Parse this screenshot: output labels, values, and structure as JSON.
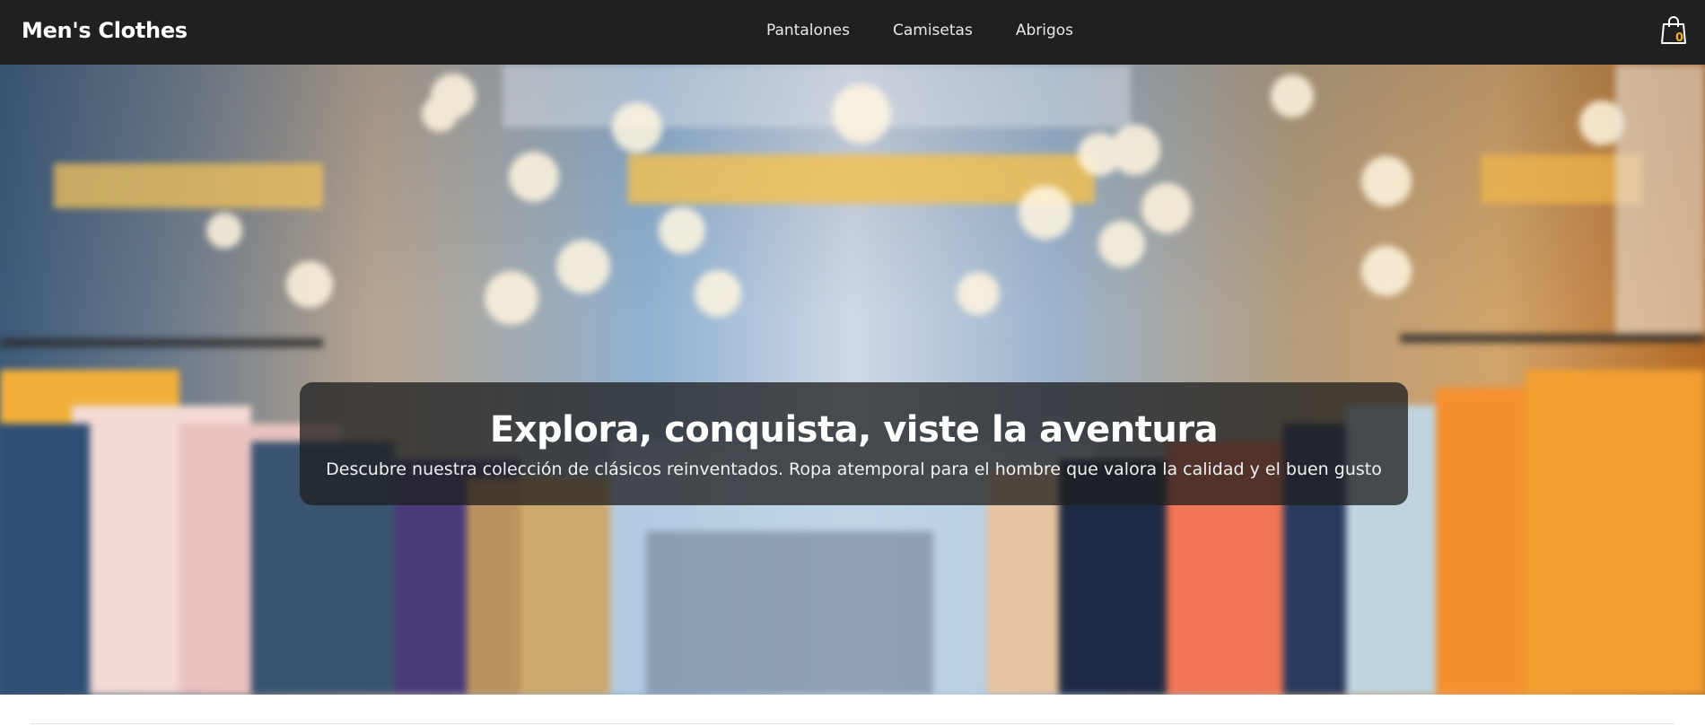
{
  "header": {
    "brand": "Men's Clothes",
    "nav": [
      {
        "label": "Pantalones"
      },
      {
        "label": "Camisetas"
      },
      {
        "label": "Abrigos"
      }
    ],
    "cart": {
      "icon": "shopping-bag-icon",
      "count": "0"
    }
  },
  "hero": {
    "title": "Explora, conquista, viste la aventura",
    "subtitle": "Descubre nuestra colección de clásicos reinventados. Ropa atemporal para el hombre que valora la calidad y el buen gusto"
  },
  "colors": {
    "navbar": "#202020",
    "accent": "#f0b21a",
    "caption_bg": "#1e1e1e"
  }
}
